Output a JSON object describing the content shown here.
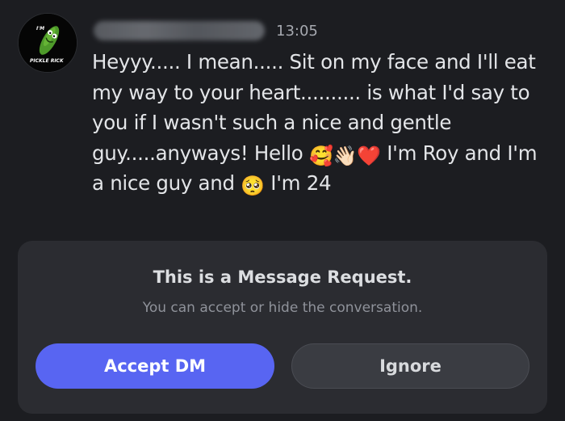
{
  "message": {
    "timestamp": "13:05",
    "avatar_text_top": "I'M",
    "avatar_text_bottom": "PICKLE RICK",
    "lines": {
      "l1": "Heyyy..... I mean..... Sit on my face and I'll eat",
      "l2": "my way to your heart.......... is what I'd say to",
      "l3": "you if I wasn't such a nice and gentle",
      "l4a": "guy.....anyways! Hello ",
      "l4b": " I'm Roy and I'm",
      "l5a": "a nice guy  and ",
      "l5b": " I'm 24"
    },
    "emoji": {
      "smiling_hearts": "🥰",
      "waving_hand": "👋🏻",
      "red_heart": "❤️",
      "pleading_face": "🥺"
    }
  },
  "request": {
    "title": "This is a Message Request.",
    "subtitle": "You can accept or hide the conversation.",
    "accept_label": "Accept DM",
    "ignore_label": "Ignore"
  },
  "colors": {
    "background": "#1c1d21",
    "card": "#2b2c31",
    "accept": "#5865f2",
    "ignore": "#3a3c42",
    "text": "#e3e5e8"
  }
}
